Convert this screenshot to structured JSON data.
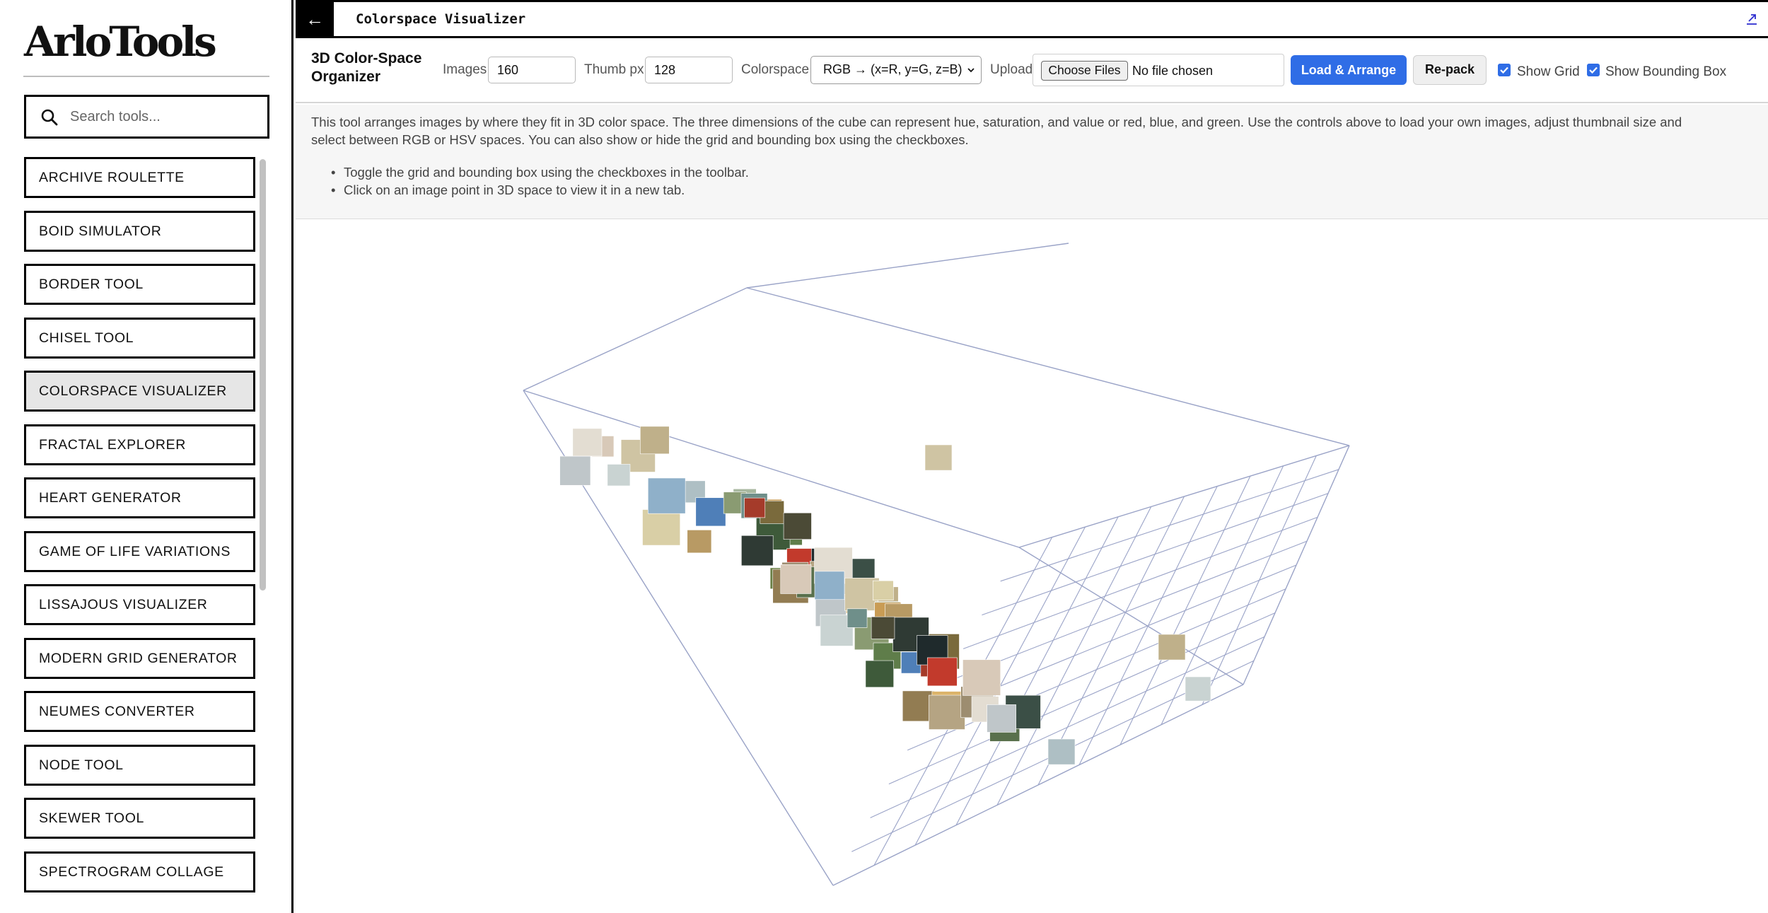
{
  "sidebar": {
    "logo": "ArloTools",
    "search_placeholder": "Search tools...",
    "items": [
      {
        "label": "ARCHIVE ROULETTE",
        "active": false
      },
      {
        "label": "BOID SIMULATOR",
        "active": false
      },
      {
        "label": "BORDER TOOL",
        "active": false
      },
      {
        "label": "CHISEL TOOL",
        "active": false
      },
      {
        "label": "COLORSPACE VISUALIZER",
        "active": true
      },
      {
        "label": "FRACTAL EXPLORER",
        "active": false
      },
      {
        "label": "HEART GENERATOR",
        "active": false
      },
      {
        "label": "GAME OF LIFE VARIATIONS",
        "active": false
      },
      {
        "label": "LISSAJOUS VISUALIZER",
        "active": false
      },
      {
        "label": "MODERN GRID GENERATOR",
        "active": false
      },
      {
        "label": "NEUMES CONVERTER",
        "active": false
      },
      {
        "label": "NODE TOOL",
        "active": false
      },
      {
        "label": "SKEWER TOOL",
        "active": false
      },
      {
        "label": "SPECTROGRAM COLLAGE",
        "active": false
      }
    ]
  },
  "titlebar": {
    "back_label": "←",
    "title": "Colorspace Visualizer"
  },
  "toolbar": {
    "heading": "3D Color-Space Organizer",
    "images_label": "Images",
    "images_value": "160",
    "thumb_label": "Thumb px",
    "thumb_value": "128",
    "colorspace_label": "Colorspace",
    "colorspace_value": "RGB → (x=R, y=G, z=B)",
    "upload_label": "Upload",
    "choose_files_label": "Choose Files",
    "file_status": "No file chosen",
    "load_button": "Load & Arrange",
    "repack_button": "Re-pack",
    "show_grid_label": "Show Grid",
    "show_grid_checked": true,
    "show_bbox_label": "Show Bounding Box",
    "show_bbox_checked": true
  },
  "info": {
    "description": "This tool arranges images by where they fit in 3D color space. The three dimensions of the cube can represent hue, saturation, and value or red, blue, and green. Use the controls above to load your own images, adjust thumbnail size and select between RGB or HSV spaces. You can also show or hide the grid and bounding box using the checkboxes.",
    "tips": [
      "Toggle the grid and bounding box using the checkboxes in the toolbar.",
      "Click on an image point in 3D space to view it in a new tab."
    ]
  },
  "scene": {
    "accent_color": "#2f6de6",
    "box_line_color": "#9aa3c7",
    "thumbnail_colors": [
      "#d8c9b8",
      "#e3ddd2",
      "#bfc6c9",
      "#cfc4a3",
      "#bfb08a",
      "#c9d3d2",
      "#aebfc4",
      "#d9cfa6",
      "#8fb0c9",
      "#4f7fb8",
      "#a8b8a0",
      "#c99c55",
      "#8a9b72",
      "#6f8f8a",
      "#b89a64",
      "#5f7d4a",
      "#3e5a3a",
      "#7a6a3c",
      "#a53b2a",
      "#2f3a34",
      "#4b4a36",
      "#1f2a2c",
      "#c23a2c",
      "#6a7f45",
      "#927c52",
      "#dcb46a",
      "#b5a483",
      "#9d8d70",
      "#59704c",
      "#3b4f46"
    ]
  }
}
